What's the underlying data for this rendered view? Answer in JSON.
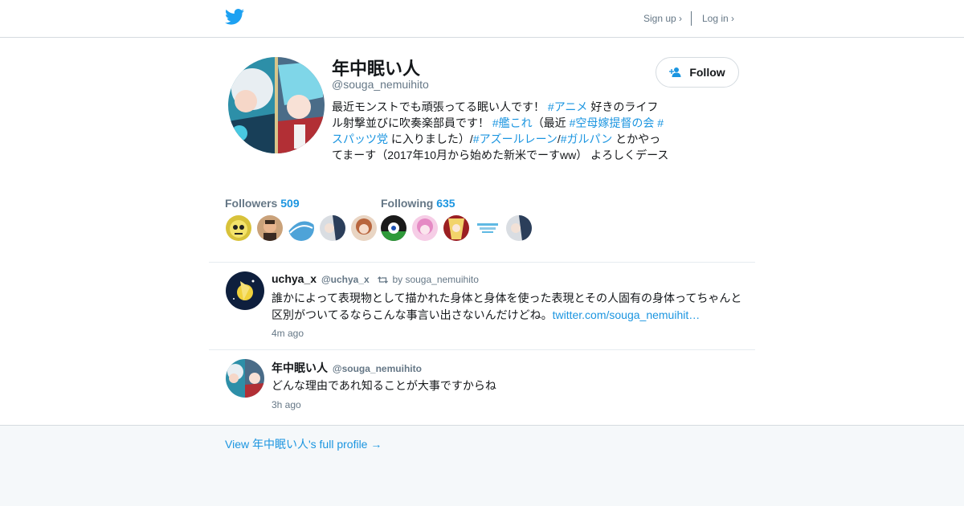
{
  "colors": {
    "link": "#1b95e0",
    "muted": "#657786",
    "text": "#14171a",
    "border": "#d5dbe0",
    "footer_bg": "#f5f8fa"
  },
  "header": {
    "logo_icon": "twitter-bird-icon",
    "signup_label": "Sign up ›",
    "login_label": "Log in ›"
  },
  "profile": {
    "display_name": "年中眠い人",
    "screen_name": "@souga_nemuihito",
    "follow_label": "Follow",
    "follow_icon": "person-add-icon",
    "bio": {
      "t1": "最近モンストでも頑張ってる眠い人です！ ",
      "h1": "#アニメ",
      "t2": " 好きのライフル射撃並びに吹奏楽部員です！ ",
      "h2": "#艦これ",
      "t3": "（最近 ",
      "h3": "#空母嫁提督の会",
      "t4": " ",
      "h4": "#スパッツ党",
      "t5": " に入りました）/",
      "h5": "#アズールレーン",
      "t6": "/",
      "h6": "#ガルパン",
      "t7": " とかやってまーす（2017年10月から始めた新米でーすww） よろしくデース"
    }
  },
  "stats": {
    "followers_label": "Followers",
    "followers_count": "509",
    "following_label": "Following",
    "following_count": "635"
  },
  "tweets": [
    {
      "name": "uchya_x",
      "handle": "@uchya_x",
      "retweet_icon": "retweet-icon",
      "retweet_by": "by souga_nemuihito",
      "text": "誰かによって表現物として描かれた身体と身体を使った表現とその人固有の身体ってちゃんと区別がついてるならこんな事言い出さないんだけどね。",
      "link": "twitter.com/souga_nemuihit…",
      "time": "4m ago"
    },
    {
      "name": "年中眠い人",
      "handle": "@souga_nemuihito",
      "text": "どんな理由であれ知ることが大事ですからね",
      "time": "3h ago"
    }
  ],
  "footer": {
    "link": "View 年中眠い人's full profile →"
  }
}
